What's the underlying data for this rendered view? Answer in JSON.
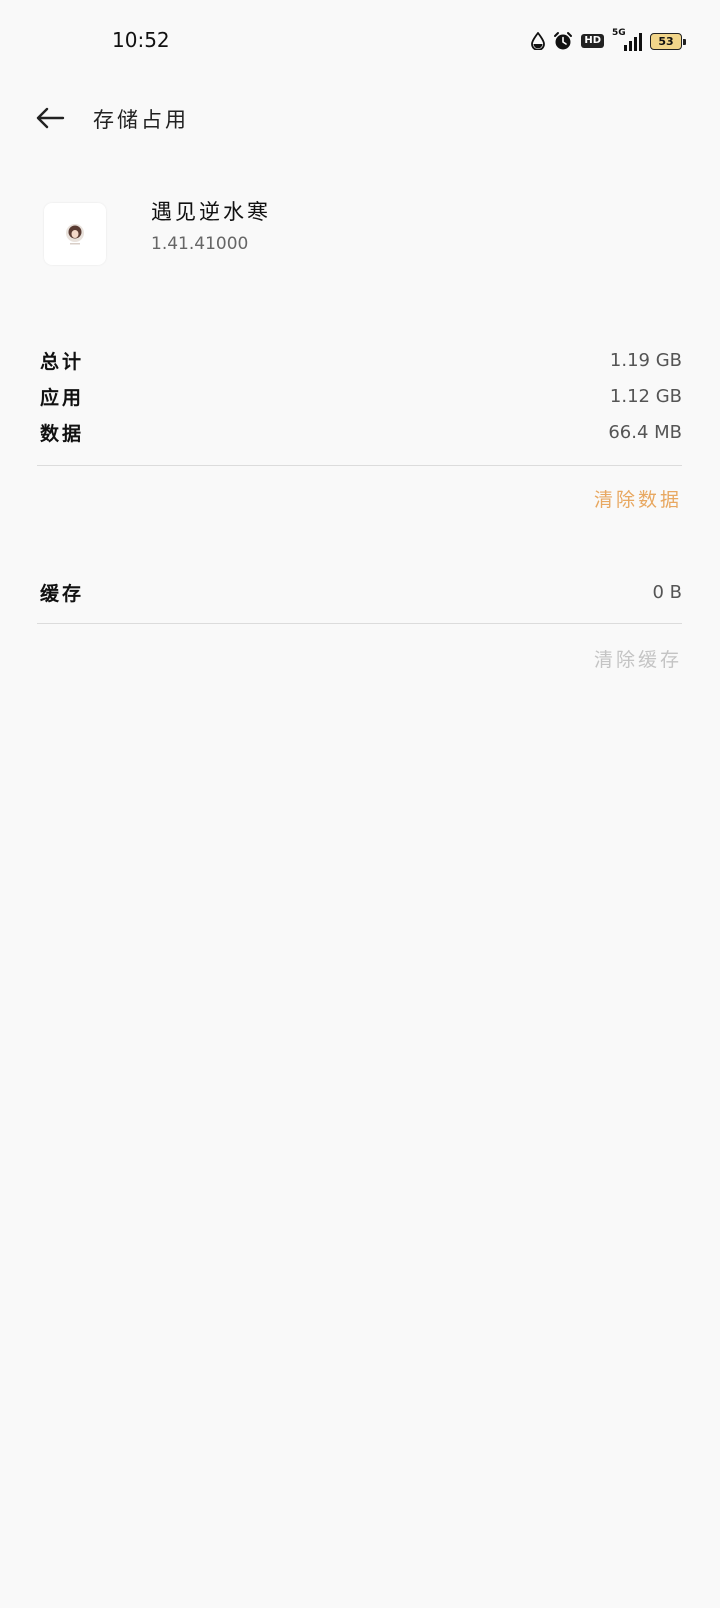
{
  "status_bar": {
    "time": "10:52",
    "network": "5G",
    "hd": "HD",
    "battery": "53",
    "icons": [
      "drop-icon",
      "alarm-icon",
      "hd-icon",
      "signal-icon",
      "battery-icon"
    ]
  },
  "header": {
    "title": "存储占用",
    "back_icon": "arrow-left-icon"
  },
  "app": {
    "name": "遇见逆水寒",
    "version": "1.41.41000",
    "icon": "app-avatar-icon"
  },
  "storage": {
    "rows": [
      {
        "label": "总计",
        "value": "1.19 GB"
      },
      {
        "label": "应用",
        "value": "1.12 GB"
      },
      {
        "label": "数据",
        "value": "66.4 MB"
      }
    ],
    "clear_data_label": "清除数据"
  },
  "cache": {
    "label": "缓存",
    "value": "0 B",
    "clear_cache_label": "清除缓存"
  },
  "colors": {
    "accent": "#e8a861",
    "disabled": "#c4c4c4",
    "background": "#f9f9f9",
    "divider": "#dcdcdc"
  }
}
